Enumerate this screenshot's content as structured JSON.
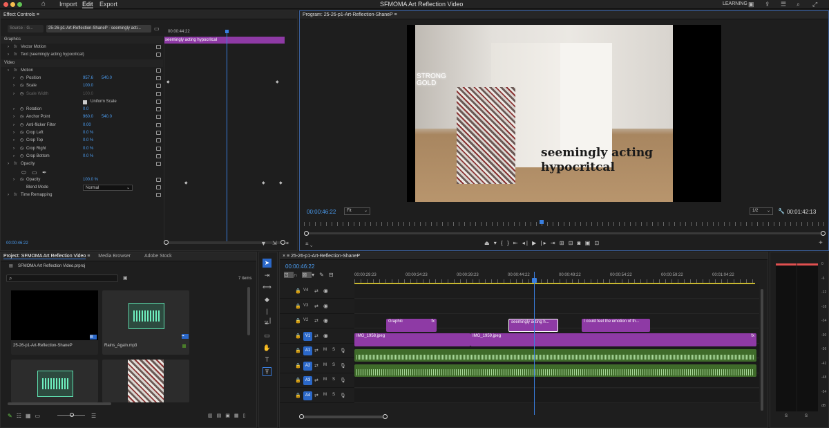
{
  "menu": {
    "items": [
      "Import",
      "Edit",
      "Export"
    ],
    "active": "Edit",
    "title": "SFMOMA Art Reflection Video",
    "workspace": "LEARNING"
  },
  "effect_controls": {
    "panel_title": "Effect Controls",
    "source_tab": "Source · G...",
    "sequence_tab": "25-26-p1-Art-Reflection-ShaneP · seemingly acti...",
    "timecode_top": "00:00:44:22",
    "clip_label": "seemingly acting hypocritcal",
    "rows": [
      {
        "label": "Graphics",
        "kind": "section"
      },
      {
        "label": "Vector Motion",
        "kind": "fx"
      },
      {
        "label": "Text (seemingly acting hypocritcal)",
        "kind": "fx"
      },
      {
        "label": "Video",
        "kind": "section"
      },
      {
        "label": "Motion",
        "kind": "fx"
      },
      {
        "label": "Position",
        "v1": "957.6",
        "v2": "540.0",
        "kind": "prop"
      },
      {
        "label": "Scale",
        "v1": "100.0",
        "kind": "prop"
      },
      {
        "label": "Scale Width",
        "v1": "100.0",
        "kind": "dimprop"
      },
      {
        "label": "Uniform Scale",
        "kind": "check"
      },
      {
        "label": "Rotation",
        "v1": "0.0",
        "kind": "prop"
      },
      {
        "label": "Anchor Point",
        "v1": "960.0",
        "v2": "540.0",
        "kind": "prop"
      },
      {
        "label": "Anti-flicker Filter",
        "v1": "0.00",
        "kind": "prop"
      },
      {
        "label": "Crop Left",
        "v1": "0.0 %",
        "kind": "prop"
      },
      {
        "label": "Crop Top",
        "v1": "0.0 %",
        "kind": "prop"
      },
      {
        "label": "Crop Right",
        "v1": "0.0 %",
        "kind": "prop"
      },
      {
        "label": "Crop Bottom",
        "v1": "0.0 %",
        "kind": "prop"
      },
      {
        "label": "Opacity",
        "kind": "fx"
      },
      {
        "label": "",
        "kind": "masks"
      },
      {
        "label": "Opacity",
        "v1": "100.0 %",
        "kind": "prop"
      },
      {
        "label": "Blend Mode",
        "v1": "Normal",
        "kind": "select"
      },
      {
        "label": "Time Remapping",
        "kind": "fx"
      }
    ],
    "timecode_bottom": "00:00:46:22"
  },
  "program": {
    "title": "Program: 25-26-p1-Art-Reflection-ShaneP",
    "caption_line1": "seemingly acting",
    "caption_line2": "hypocritcal",
    "neon_text": "STRONG\nGOLD",
    "timecode": "00:00:46:22",
    "fit": "Fit",
    "quality": "1/2",
    "duration": "00:01:42:13"
  },
  "project": {
    "tabs": [
      "Project: SFMOMA Art Reflection Video",
      "Media Browser",
      "Adobe Stock"
    ],
    "file": "SFMOMA Art Reflection Video.prproj",
    "items_count": "7 items",
    "thumbs": [
      {
        "label": "25-26-p1-Art-Reflection-ShaneP",
        "type": "sequence"
      },
      {
        "label": "Rains_Again.mp3",
        "type": "audio"
      },
      {
        "label": "",
        "type": "audio"
      },
      {
        "label": "",
        "type": "image"
      }
    ]
  },
  "timeline": {
    "tab": "25-26-p1-Art-Reflection-ShaneP",
    "timecode": "00:00:46:22",
    "ruler": [
      "00:00:29:23",
      "00:00:34:23",
      "00:00:39:23",
      "00:00:44:22",
      "00:00:49:22",
      "00:00:54:22",
      "00:00:59:22",
      "00:01:04:22"
    ],
    "tracks": [
      "V4",
      "V3",
      "V2",
      "V1",
      "A1",
      "A2",
      "A3",
      "A4"
    ],
    "clips": {
      "graphic": "Graphic",
      "seemingly": "seemingly acting h...",
      "feel": "I could feel the emotion of th...",
      "img1958": "IMG_1958.jpeg",
      "img1959": "IMG_1959.jpeg"
    }
  },
  "meter": {
    "scale": [
      "0",
      "-6",
      "-12",
      "-18",
      "-24",
      "-30",
      "-36",
      "-42",
      "-48",
      "-54",
      "dB"
    ],
    "channels": [
      "S",
      "S"
    ]
  }
}
